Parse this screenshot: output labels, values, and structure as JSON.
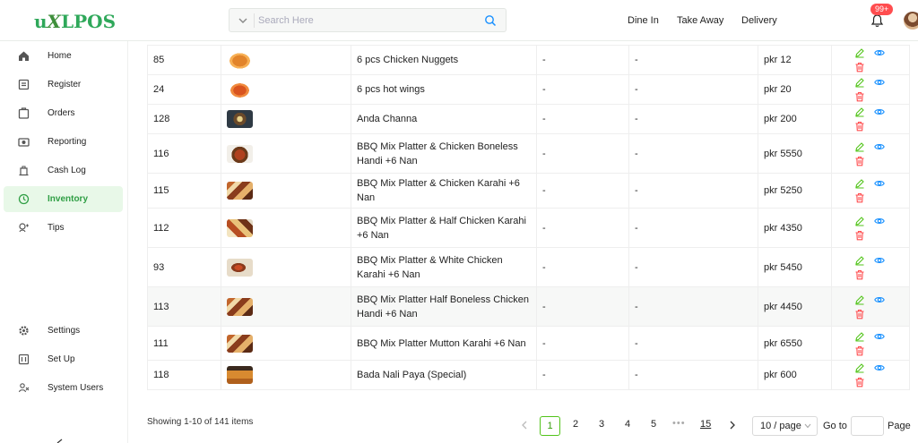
{
  "header": {
    "logo": "uXLPOS",
    "search_placeholder": "Search Here",
    "nav": [
      "Dine In",
      "Take Away",
      "Delivery"
    ],
    "notification_count": "99+"
  },
  "sidebar": {
    "items": [
      {
        "label": "Home",
        "icon": "home-icon"
      },
      {
        "label": "Register",
        "icon": "register-icon"
      },
      {
        "label": "Orders",
        "icon": "orders-icon"
      },
      {
        "label": "Reporting",
        "icon": "reporting-icon"
      },
      {
        "label": "Cash Log",
        "icon": "cash-log-icon"
      },
      {
        "label": "Inventory",
        "icon": "inventory-icon",
        "active": true
      },
      {
        "label": "Tips",
        "icon": "tips-icon"
      },
      {
        "label": "Settings",
        "icon": "settings-icon"
      },
      {
        "label": "Set Up",
        "icon": "setup-icon"
      },
      {
        "label": "System Users",
        "icon": "users-icon"
      }
    ]
  },
  "table": {
    "rows": [
      {
        "id": "85",
        "name": "6 pcs Chicken Nuggets",
        "col3": "-",
        "col4": "-",
        "price": "pkr 12",
        "thumb": "nuggets"
      },
      {
        "id": "24",
        "name": "6 pcs hot wings",
        "col3": "-",
        "col4": "-",
        "price": "pkr 20",
        "thumb": "wings"
      },
      {
        "id": "128",
        "name": "Anda Channa",
        "col3": "-",
        "col4": "-",
        "price": "pkr 200",
        "thumb": "bowl"
      },
      {
        "id": "116",
        "name": "BBQ Mix Platter & Chicken Boneless Handi +6 Nan",
        "col3": "-",
        "col4": "-",
        "price": "pkr 5550",
        "thumb": "handi"
      },
      {
        "id": "115",
        "name": "BBQ Mix Platter & Chicken Karahi +6 Nan",
        "col3": "-",
        "col4": "-",
        "price": "pkr 5250",
        "thumb": "platter"
      },
      {
        "id": "112",
        "name": "BBQ Mix Platter & Half Chicken Karahi +6 Nan",
        "col3": "-",
        "col4": "-",
        "price": "pkr 4350",
        "thumb": "platter2"
      },
      {
        "id": "93",
        "name": "BBQ Mix Platter & White Chicken Karahi +6 Nan",
        "col3": "-",
        "col4": "-",
        "price": "pkr 5450",
        "thumb": "plate"
      },
      {
        "id": "113",
        "name": "BBQ Mix Platter Half Boneless Chicken Handi +6 Nan",
        "col3": "-",
        "col4": "-",
        "price": "pkr 4450",
        "thumb": "platter"
      },
      {
        "id": "111",
        "name": "BBQ Mix Platter Mutton Karahi +6 Nan",
        "col3": "-",
        "col4": "-",
        "price": "pkr 6550",
        "thumb": "platter"
      },
      {
        "id": "118",
        "name": "Bada Nali Paya (Special)",
        "col3": "-",
        "col4": "-",
        "price": "pkr 600",
        "thumb": "paya"
      }
    ],
    "actions": [
      "edit-icon",
      "view-icon",
      "delete-icon"
    ]
  },
  "footer": {
    "showing": "Showing 1-10 of 141 items",
    "pages": [
      "1",
      "2",
      "3",
      "4",
      "5",
      "15"
    ],
    "current_page": "1",
    "ellipsis": "•••",
    "per_page": "10 / page",
    "goto_label": "Go to",
    "page_label": "Page"
  },
  "colors": {
    "brand": "#2fa85a",
    "active_bg": "#e8f8e8",
    "edit": "#52c41a",
    "view": "#1890ff",
    "delete": "#ff4d4f"
  }
}
